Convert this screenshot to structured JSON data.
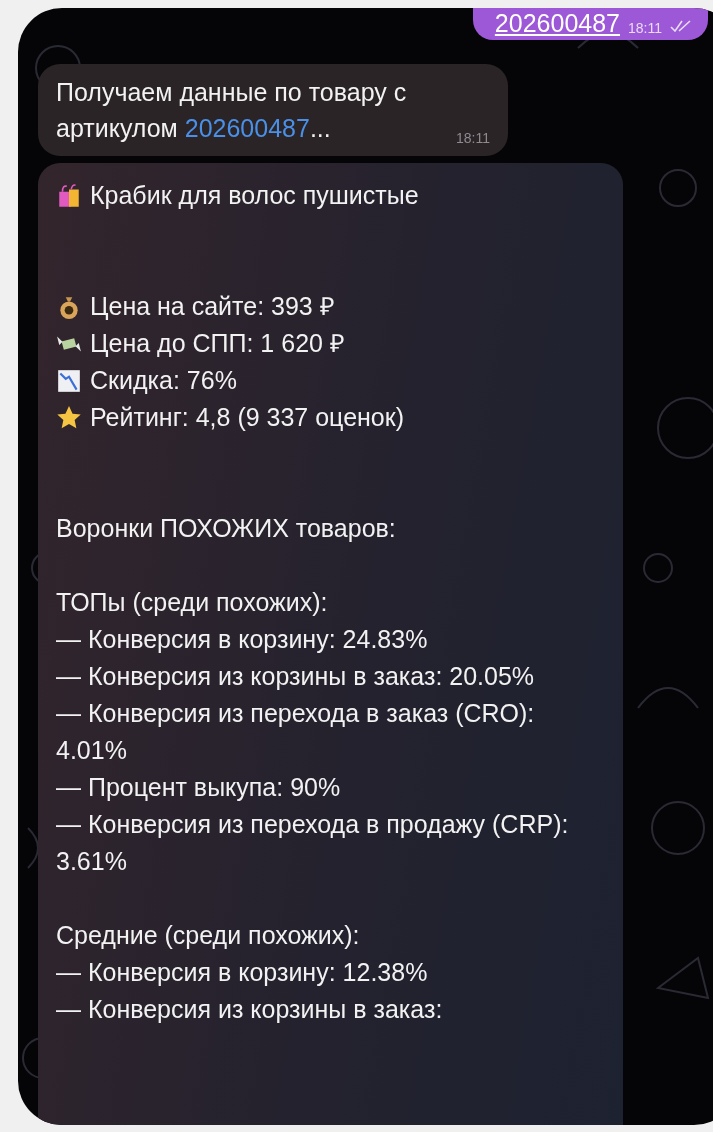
{
  "outgoing": {
    "text": "202600487",
    "time": "18:11",
    "read": true
  },
  "status_message": {
    "text": "Получаем данные по товару с артикулом ",
    "link": "202600487",
    "suffix": "...",
    "time": "18:11"
  },
  "product_message": {
    "title": "Крабик для волос пушистые",
    "stats": [
      {
        "kind": "money-bag",
        "text": "Цена на сайте: 393 ₽"
      },
      {
        "kind": "money-wings",
        "text": "Цена до СПП: 1 620 ₽"
      },
      {
        "kind": "chart-down",
        "text": "Скидка: 76%"
      },
      {
        "kind": "star",
        "text": "Рейтинг: 4,8 (9 337 оценок)"
      }
    ],
    "heading": "Воронки ПОХОЖИХ товаров:",
    "groups": [
      {
        "title": "ТОПы (среди похожих):",
        "items": [
          "— Конверсия в корзину: 24.83%",
          "— Конверсия из корзины в заказ: 20.05%",
          "— Конверсия из перехода в заказ (CRO): 4.01%",
          "— Процент выкупа: 90%",
          "— Конверсия из перехода в продажу (CRP): 3.61%"
        ]
      },
      {
        "title": "Средние (среди похожих):",
        "items": [
          "— Конверсия в корзину: 12.38%",
          "— Конверсия из корзины в заказ:"
        ]
      }
    ]
  }
}
